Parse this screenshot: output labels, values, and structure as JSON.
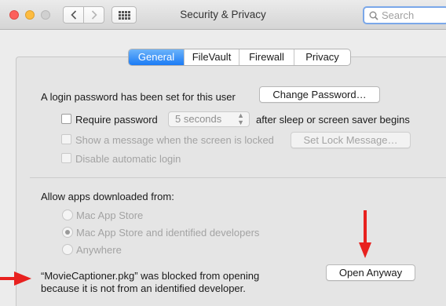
{
  "window": {
    "title": "Security & Privacy"
  },
  "search": {
    "placeholder": "Search"
  },
  "tabs": [
    {
      "label": "General",
      "active": true
    },
    {
      "label": "FileVault",
      "active": false
    },
    {
      "label": "Firewall",
      "active": false
    },
    {
      "label": "Privacy",
      "active": false
    }
  ],
  "general": {
    "password_text": "A login password has been set for this user",
    "change_password_label": "Change Password…",
    "require_password_label": "Require password",
    "require_password_select": "5 seconds",
    "after_sleep_text": "after sleep or screen saver begins",
    "show_message_label": "Show a message when the screen is locked",
    "set_lock_message_label": "Set Lock Message…",
    "disable_login_label": "Disable automatic login",
    "allow_apps_label": "Allow apps downloaded from:",
    "radio_options": [
      {
        "label": "Mac App Store",
        "selected": false
      },
      {
        "label": "Mac App Store and identified developers",
        "selected": true
      },
      {
        "label": "Anywhere",
        "selected": false
      }
    ],
    "blocked_line1": "“MovieCaptioner.pkg” was blocked from opening",
    "blocked_line2": "because it is not from an identified developer.",
    "open_anyway_label": "Open Anyway"
  },
  "colors": {
    "accent": "#1b7bf5",
    "annotation_arrow": "#e8211f"
  }
}
